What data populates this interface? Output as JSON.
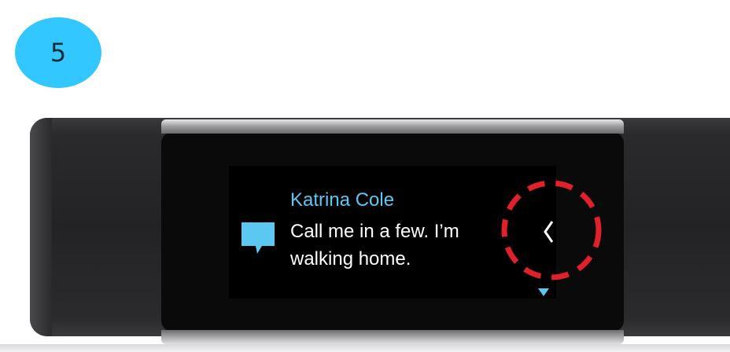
{
  "step": {
    "number": "5"
  },
  "notification": {
    "sender": "Katrina Cole",
    "message_line_1": "Call me in a few. I’m",
    "message_line_2": "walking home."
  },
  "icons": {
    "message": "message-bubble-icon",
    "chevron": "chevron-left-icon",
    "scroll": "scroll-down-indicator-icon"
  },
  "colors": {
    "badge": "#33c7ff",
    "accent": "#5bc8f2",
    "highlight": "#e0202a"
  }
}
